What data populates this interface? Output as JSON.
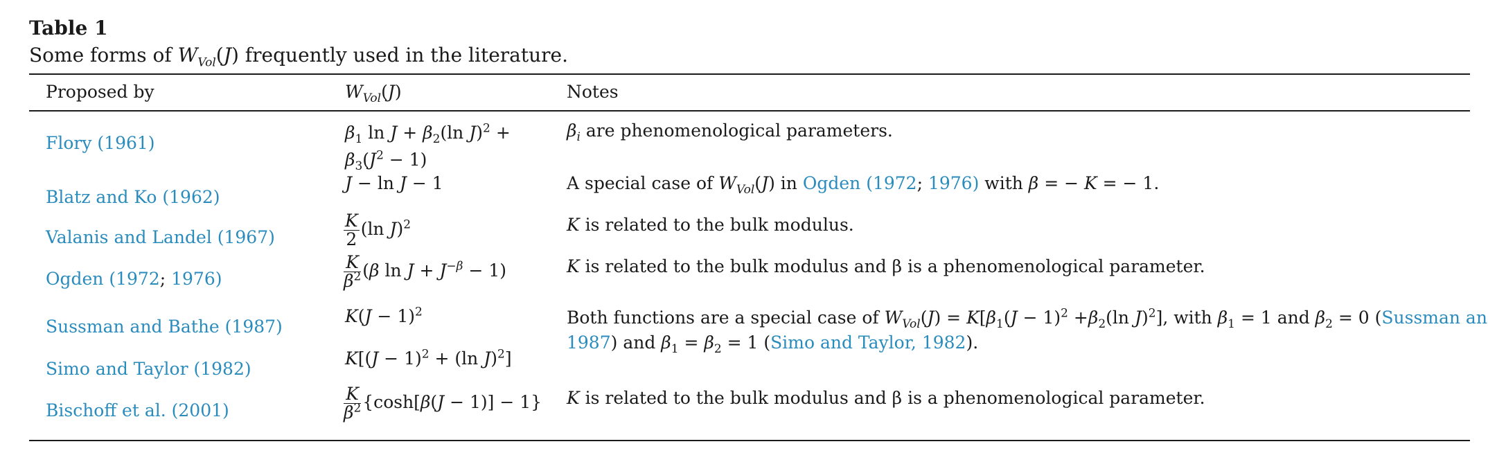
{
  "caption": {
    "label": "Table 1",
    "text_prefix": "Some forms of ",
    "text_suffix": " frequently used in the literature."
  },
  "headers": [
    "Proposed by",
    "W",
    "Notes"
  ],
  "rows": [
    {
      "author": "Flory (1961)",
      "note": "are phenomenological parameters."
    },
    {
      "author": "Blatz and Ko (1962)",
      "note_a": "A special case of ",
      "note_b": " in ",
      "note_ref1": "Ogden (1972",
      "note_sep": "; ",
      "note_ref2": "1976)",
      "note_c": " with "
    },
    {
      "author": "Valanis and Landel (1967)",
      "note": "is related to the bulk modulus."
    },
    {
      "author_a": "Ogden (1972",
      "author_sep": "; ",
      "author_b": "1976)",
      "note": "is related to the bulk modulus and β is a phenomenological parameter."
    },
    {
      "author": "Sussman and Bathe (1987)",
      "note_a": "Both functions are a special case of ",
      "note_b": ", with ",
      "note_c": " and ",
      "note_d": " (",
      "note_ref1": "Sussman and Bathe,",
      "note_ref1b": "1987",
      "note_e": ") and ",
      "note_f": " (",
      "note_ref2": "Simo and Taylor, 1982",
      "note_g": ")."
    },
    {
      "author": "Simo and Taylor (1982)"
    },
    {
      "author": "Bischoff et al. (2001)",
      "note": "is related to the bulk modulus and β is a phenomenological parameter."
    }
  ]
}
